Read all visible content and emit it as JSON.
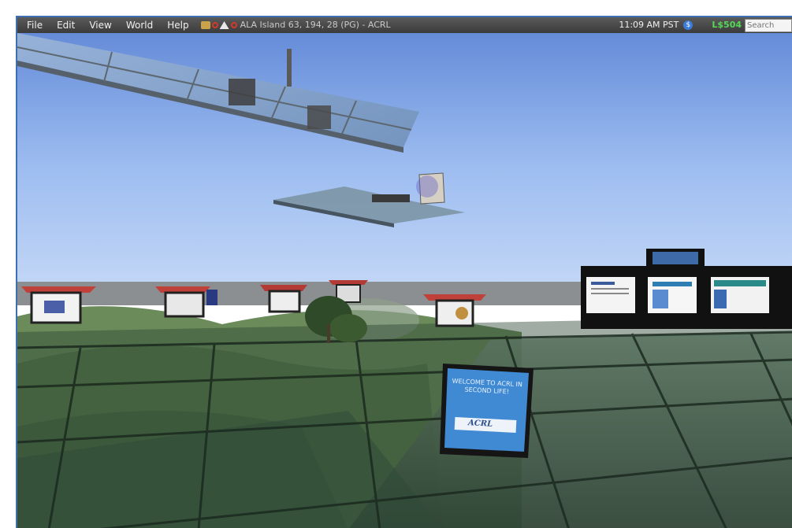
{
  "menu": {
    "items": [
      "File",
      "Edit",
      "View",
      "World",
      "Help"
    ]
  },
  "status": {
    "location": "ALA Island 63, 194, 28 (PG) - ACRL",
    "time": "11:09 AM PST",
    "balance": "L$504"
  },
  "search": {
    "placeholder": "Search"
  },
  "scene": {
    "welcome_sign": {
      "line1": "WELCOME TO ACRL IN",
      "line2": "SECOND LIFE!",
      "logo": "ACRL"
    }
  },
  "icons": [
    "land-icon",
    "no-fly-icon",
    "no-build-icon",
    "linden-dollar-icon"
  ],
  "colors": {
    "menubar": "#3b3b3b",
    "balance": "#56d856",
    "sky": "#8fb2ec",
    "sign": "#3f8ad3"
  }
}
